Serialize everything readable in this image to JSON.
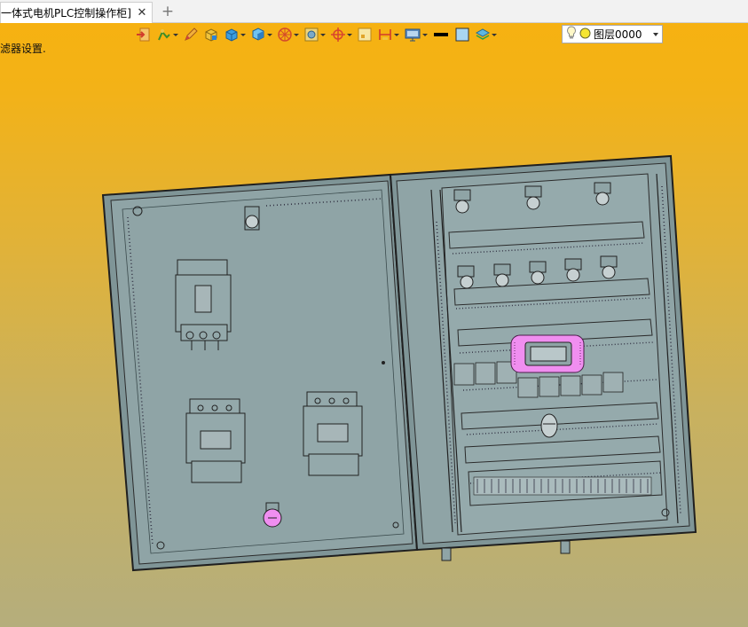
{
  "tab": {
    "title": "一体式电机PLC控制操作柜]",
    "close_glyph": "✕",
    "add_glyph": "+"
  },
  "hint_text": "滤器设置.",
  "toolbar": {
    "items": [
      {
        "icon": "exit-icon"
      },
      {
        "icon": "sketch-tool-icon"
      },
      {
        "icon": "pencil-icon"
      },
      {
        "icon": "solid-box-icon"
      },
      {
        "icon": "cube-icon"
      },
      {
        "icon": "cube-view-icon"
      },
      {
        "icon": "wheel-icon"
      },
      {
        "icon": "render-style-icon"
      },
      {
        "icon": "crosshair-icon"
      },
      {
        "icon": "frame-icon"
      },
      {
        "icon": "dimension-icon"
      },
      {
        "icon": "display-icon"
      },
      {
        "icon": "line-color-icon"
      },
      {
        "icon": "fill-color-icon"
      },
      {
        "icon": "layer-stack-icon"
      }
    ]
  },
  "layer": {
    "bulb_icon": "lightbulb-icon",
    "circle_icon": "yellow-circle-icon",
    "label": "图层0000"
  },
  "colors": {
    "panel_fill": "#8fa4a6",
    "panel_stroke": "#222222",
    "highlight": "#f08ef0",
    "background_top": "#f7b10f",
    "background_bottom": "#b5ae7c"
  }
}
